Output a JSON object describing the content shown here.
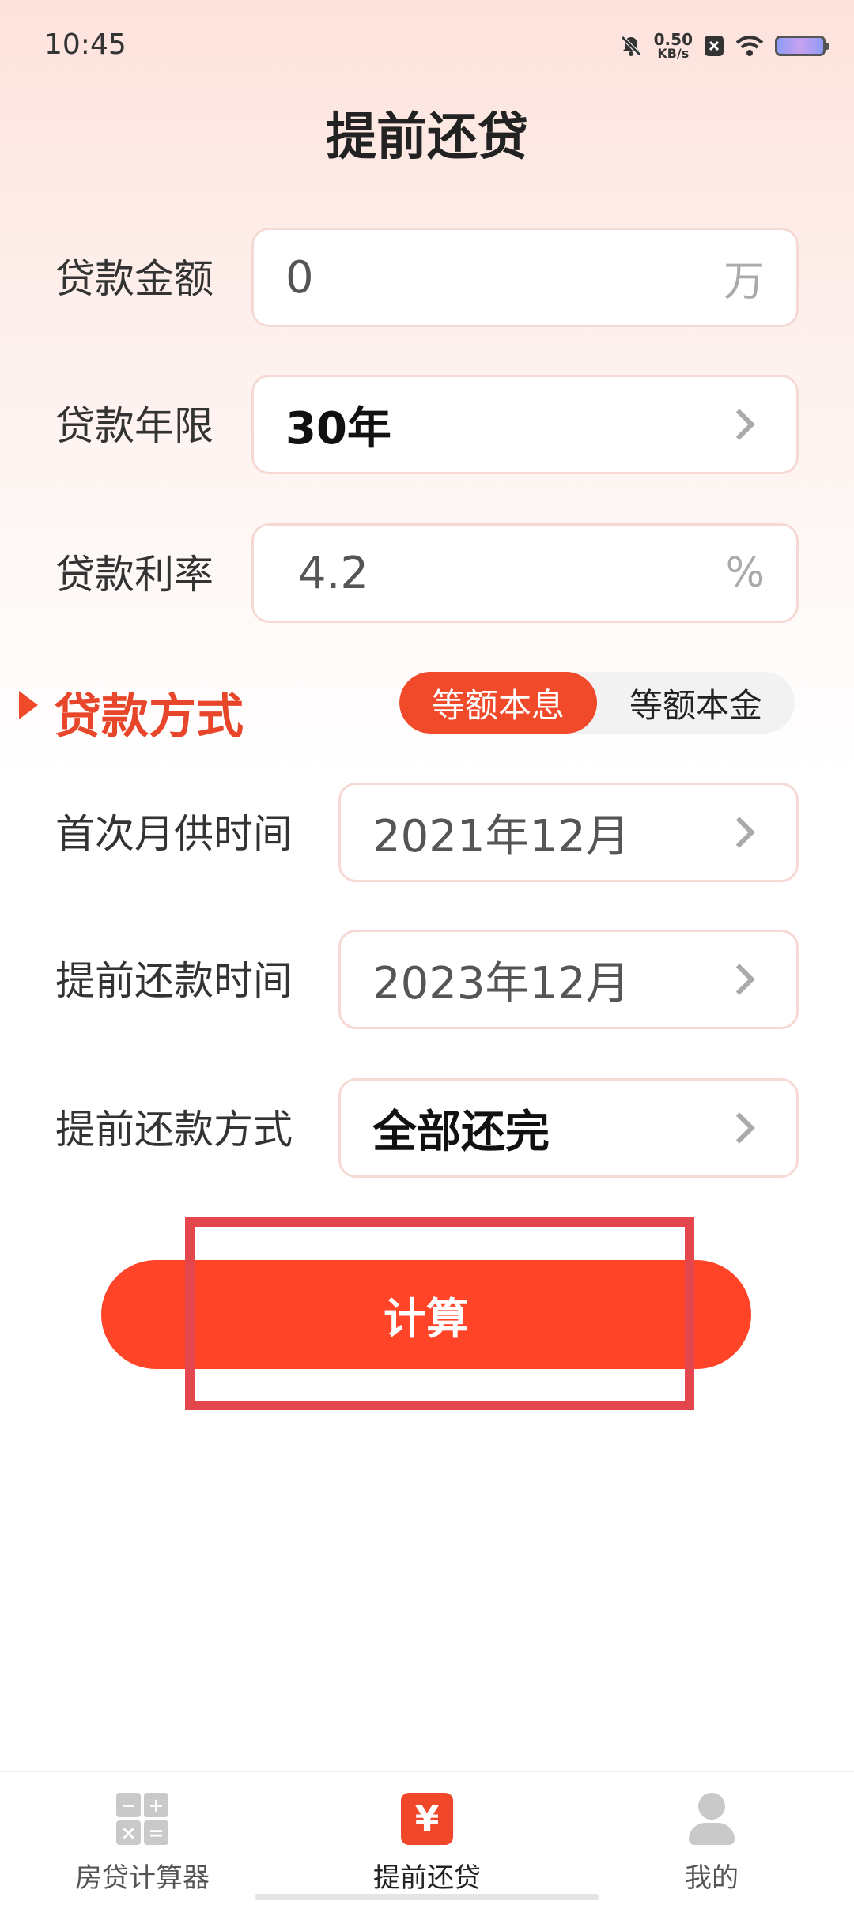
{
  "status_bar": {
    "time": "10:45",
    "net_speed_value": "0.50",
    "net_speed_unit": "KB/s",
    "icons": [
      "mute-bell-icon",
      "close-notification-icon",
      "wifi-icon",
      "battery-icon"
    ]
  },
  "header": {
    "title": "提前还贷"
  },
  "form": {
    "loan_amount": {
      "label": "贷款金额",
      "value": "0",
      "unit": "万"
    },
    "loan_term": {
      "label": "贷款年限",
      "value": "30年"
    },
    "loan_rate": {
      "label": "贷款利率",
      "value": "4.2",
      "unit": "%"
    },
    "loan_method": {
      "label": "贷款方式",
      "options": [
        "等额本息",
        "等额本金"
      ],
      "selected": "等额本息"
    },
    "first_payment": {
      "label": "首次月供时间",
      "value": "2021年12月"
    },
    "prepay_time": {
      "label": "提前还款时间",
      "value": "2023年12月"
    },
    "prepay_method": {
      "label": "提前还款方式",
      "value": "全部还完"
    }
  },
  "actions": {
    "calculate_label": "计算"
  },
  "bottom_nav": {
    "items": [
      {
        "label": "房贷计算器",
        "icon": "calculator-icon",
        "active": false
      },
      {
        "label": "提前还贷",
        "icon": "yen-icon",
        "active": true
      },
      {
        "label": "我的",
        "icon": "user-icon",
        "active": false
      }
    ]
  },
  "colors": {
    "accent": "#ff4428",
    "method_label": "#e8462b",
    "highlight_box": "#e3474d"
  }
}
